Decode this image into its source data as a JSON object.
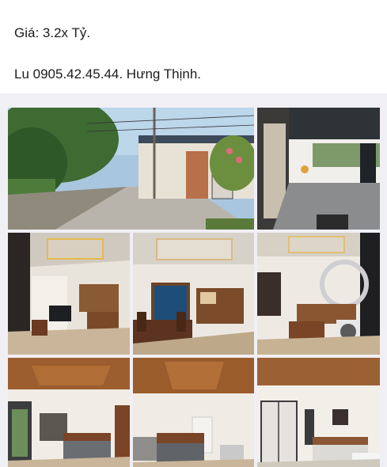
{
  "post": {
    "price_text": "Giá: 3.2x Tỷ.",
    "contact_text": "Lu 0905.42.45.44. Hưng Thịnh."
  },
  "gallery": {
    "photos": [
      {
        "name": "photo-street-view",
        "subject": "street outside house"
      },
      {
        "name": "photo-garage-hall",
        "subject": "open front hall"
      },
      {
        "name": "photo-living-room",
        "subject": "living room with tv wall"
      },
      {
        "name": "photo-dining-room",
        "subject": "dining and kitchen"
      },
      {
        "name": "photo-sofa-room",
        "subject": "living room with sofa"
      },
      {
        "name": "photo-bedroom-1",
        "subject": "bedroom wooden ceiling"
      },
      {
        "name": "photo-bedroom-2",
        "subject": "bedroom wooden ceiling"
      },
      {
        "name": "photo-bedroom-3",
        "subject": "bedroom with wardrobe"
      }
    ]
  }
}
